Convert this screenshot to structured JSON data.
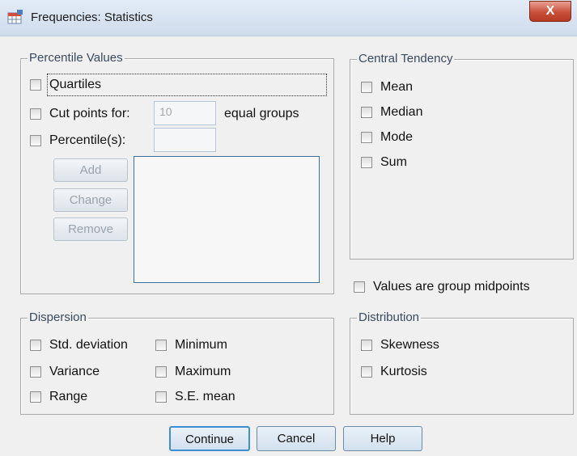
{
  "window": {
    "title": "Frequencies: Statistics",
    "close_label": "X"
  },
  "percentile_values": {
    "legend": "Percentile Values",
    "quartiles": "Quartiles",
    "cut_points": "Cut points for:",
    "cut_points_value": "10",
    "equal_groups": "equal groups",
    "percentiles": "Percentile(s):",
    "percentiles_value": "",
    "add": "Add",
    "change": "Change",
    "remove": "Remove"
  },
  "central_tendency": {
    "legend": "Central Tendency",
    "mean": "Mean",
    "median": "Median",
    "mode": "Mode",
    "sum": "Sum"
  },
  "group_midpoints": "Values are group midpoints",
  "dispersion": {
    "legend": "Dispersion",
    "std_deviation": "Std. deviation",
    "variance": "Variance",
    "range": "Range",
    "minimum": "Minimum",
    "maximum": "Maximum",
    "se_mean": "S.E. mean"
  },
  "distribution": {
    "legend": "Distribution",
    "skewness": "Skewness",
    "kurtosis": "Kurtosis"
  },
  "buttons": {
    "continue": "Continue",
    "cancel": "Cancel",
    "help": "Help"
  }
}
